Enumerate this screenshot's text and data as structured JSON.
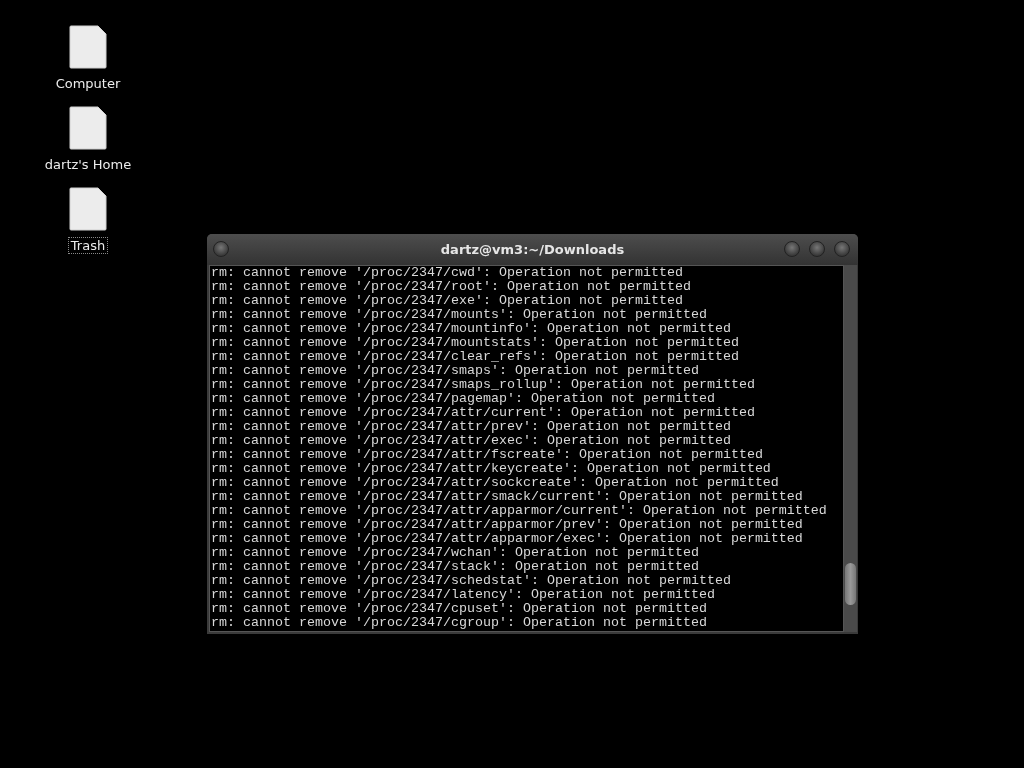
{
  "desktop_icons": [
    {
      "label": "Computer",
      "selected": false
    },
    {
      "label": "dartz's Home",
      "selected": false
    },
    {
      "label": "Trash",
      "selected": true
    }
  ],
  "window": {
    "title": "dartz@vm3:~/Downloads"
  },
  "terminal_lines": [
    "rm: cannot remove '/proc/2347/cwd': Operation not permitted",
    "rm: cannot remove '/proc/2347/root': Operation not permitted",
    "rm: cannot remove '/proc/2347/exe': Operation not permitted",
    "rm: cannot remove '/proc/2347/mounts': Operation not permitted",
    "rm: cannot remove '/proc/2347/mountinfo': Operation not permitted",
    "rm: cannot remove '/proc/2347/mountstats': Operation not permitted",
    "rm: cannot remove '/proc/2347/clear_refs': Operation not permitted",
    "rm: cannot remove '/proc/2347/smaps': Operation not permitted",
    "rm: cannot remove '/proc/2347/smaps_rollup': Operation not permitted",
    "rm: cannot remove '/proc/2347/pagemap': Operation not permitted",
    "rm: cannot remove '/proc/2347/attr/current': Operation not permitted",
    "rm: cannot remove '/proc/2347/attr/prev': Operation not permitted",
    "rm: cannot remove '/proc/2347/attr/exec': Operation not permitted",
    "rm: cannot remove '/proc/2347/attr/fscreate': Operation not permitted",
    "rm: cannot remove '/proc/2347/attr/keycreate': Operation not permitted",
    "rm: cannot remove '/proc/2347/attr/sockcreate': Operation not permitted",
    "rm: cannot remove '/proc/2347/attr/smack/current': Operation not permitted",
    "rm: cannot remove '/proc/2347/attr/apparmor/current': Operation not permitted",
    "rm: cannot remove '/proc/2347/attr/apparmor/prev': Operation not permitted",
    "rm: cannot remove '/proc/2347/attr/apparmor/exec': Operation not permitted",
    "rm: cannot remove '/proc/2347/wchan': Operation not permitted",
    "rm: cannot remove '/proc/2347/stack': Operation not permitted",
    "rm: cannot remove '/proc/2347/schedstat': Operation not permitted",
    "rm: cannot remove '/proc/2347/latency': Operation not permitted",
    "rm: cannot remove '/proc/2347/cpuset': Operation not permitted",
    "rm: cannot remove '/proc/2347/cgroup': Operation not permitted"
  ]
}
